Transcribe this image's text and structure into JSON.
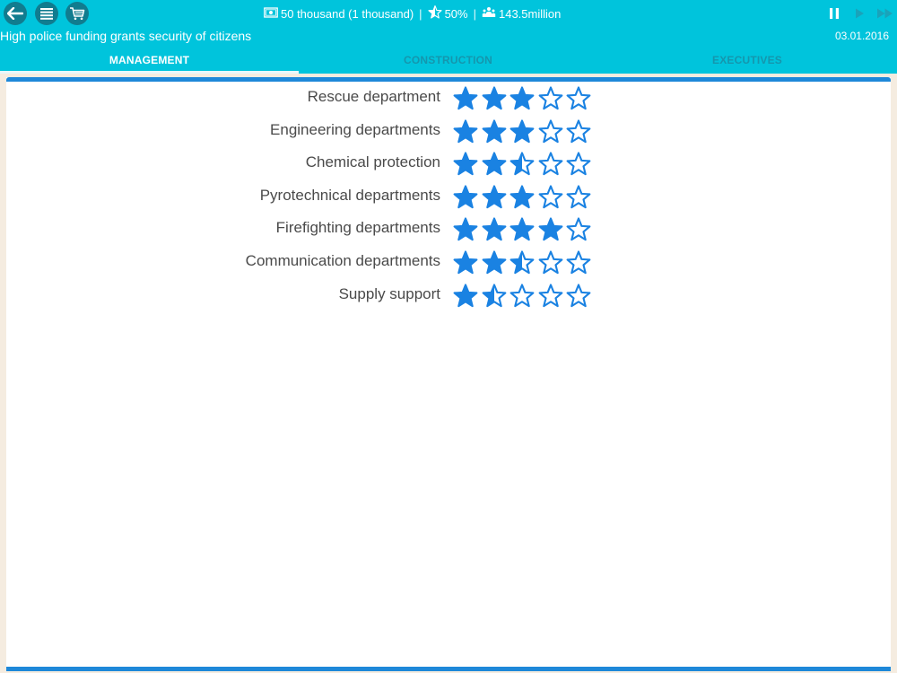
{
  "header": {
    "money": "50 thousand (1 thousand)",
    "approval": "50%",
    "population": "143.5million",
    "news": "High police funding grants security of citizens",
    "date": "03.01.2016",
    "icons": {
      "back": "back-arrow-icon",
      "menu": "menu-icon",
      "shop": "cart-icon",
      "money": "money-icon",
      "approval": "star-icon",
      "population": "population-icon",
      "pause": "pause-icon",
      "play": "play-icon",
      "fast_forward": "fast-forward-icon"
    }
  },
  "tabs": [
    {
      "label": "MANAGEMENT",
      "active": true
    },
    {
      "label": "CONSTRUCTION",
      "active": false
    },
    {
      "label": "EXECUTIVES",
      "active": false
    }
  ],
  "ratings": [
    {
      "label": "Rescue department",
      "stars": 3
    },
    {
      "label": "Engineering departments",
      "stars": 3
    },
    {
      "label": "Chemical protection",
      "stars": 2.5
    },
    {
      "label": "Pyrotechnical departments",
      "stars": 3
    },
    {
      "label": "Firefighting departments",
      "stars": 4
    },
    {
      "label": "Communication departments",
      "stars": 2.5
    },
    {
      "label": "Supply support",
      "stars": 1.5
    }
  ],
  "max_stars": 5,
  "colors": {
    "header": "#00c4dc",
    "accent": "#1e88d9",
    "star": "#1a82e2",
    "background": "#f5ece0"
  }
}
